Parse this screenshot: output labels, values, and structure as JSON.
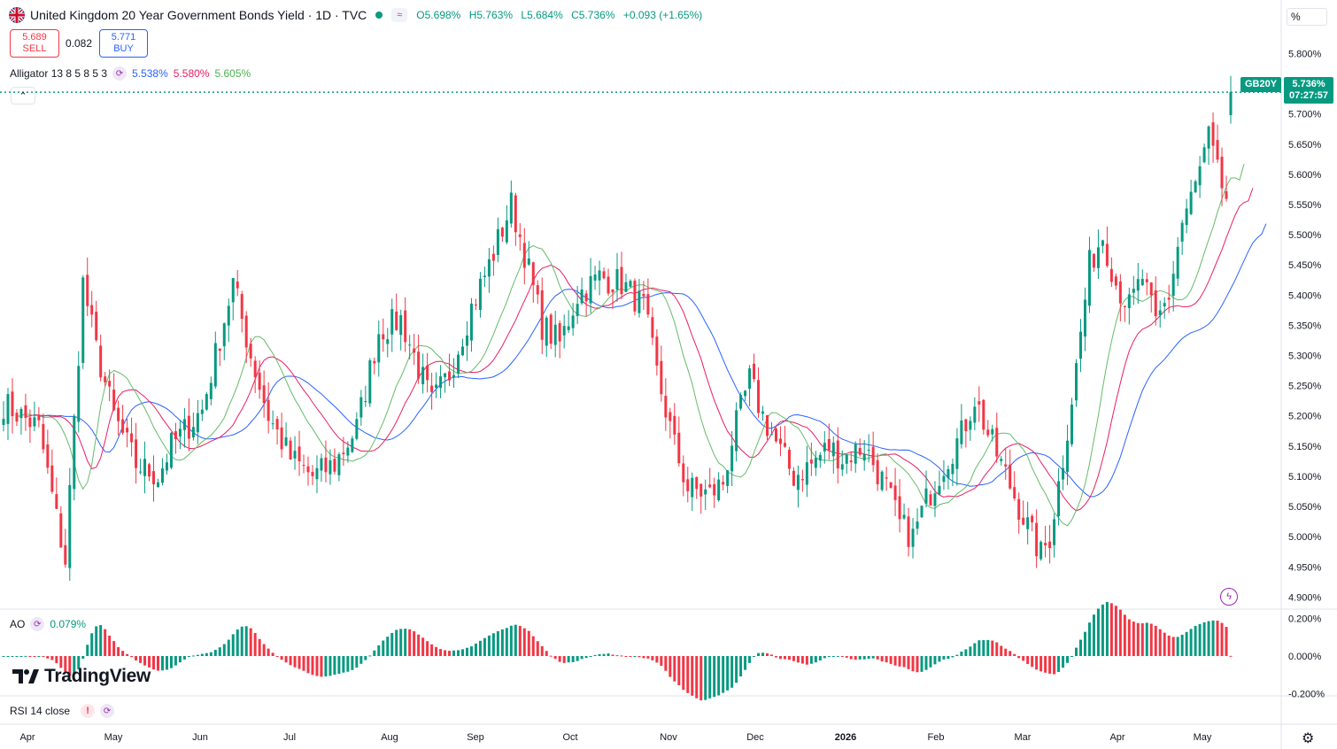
{
  "header": {
    "title": "United Kingdom 20 Year Government Bonds Yield · 1D · TVC",
    "open": "O5.698%",
    "high": "H5.763%",
    "low": "L5.684%",
    "close": "C5.736%",
    "change": "+0.093 (+1.65%)"
  },
  "trade": {
    "sell_price": "5.689",
    "sell_label": "SELL",
    "spread": "0.082",
    "buy_price": "5.771",
    "buy_label": "BUY"
  },
  "alligator": {
    "label": "Alligator 13 8 5 8 5 3",
    "jaw": "5.538%",
    "teeth": "5.580%",
    "lips": "5.605%",
    "jaw_color": "#2962ff",
    "teeth_color": "#e91e63",
    "lips_color": "#66bb6a"
  },
  "ao": {
    "label": "AO",
    "value": "0.079%"
  },
  "rsi": {
    "label": "RSI 14 close"
  },
  "brand": {
    "name": "TradingView"
  },
  "price_axis": {
    "unit": "%",
    "symbol_tag": "GB20Y",
    "last_price": "5.736%",
    "countdown": "07:27:57"
  },
  "colors": {
    "up": "#089981",
    "down": "#f23645"
  },
  "chart_data": {
    "type": "candlestick",
    "title": "United Kingdom 20 Year Government Bonds Yield",
    "interval": "1D",
    "ylim": [
      4.88,
      5.83
    ],
    "y_ticks": [
      "5.800%",
      "5.750%",
      "5.700%",
      "5.650%",
      "5.600%",
      "5.550%",
      "5.500%",
      "5.450%",
      "5.400%",
      "5.350%",
      "5.300%",
      "5.250%",
      "5.200%",
      "5.150%",
      "5.100%",
      "5.050%",
      "5.000%",
      "4.950%",
      "4.900%"
    ],
    "x_labels": [
      "Apr",
      "May",
      "Jun",
      "Jul",
      "Aug",
      "Sep",
      "Oct",
      "Nov",
      "Dec",
      "2026",
      "Feb",
      "Mar",
      "Apr",
      "May"
    ],
    "ohlc_anchors": [
      [
        0,
        5.22
      ],
      [
        8,
        5.18
      ],
      [
        12,
        5.03
      ],
      [
        14,
        4.96
      ],
      [
        18,
        5.42
      ],
      [
        21,
        5.31
      ],
      [
        25,
        5.2
      ],
      [
        30,
        5.12
      ],
      [
        35,
        5.1
      ],
      [
        38,
        5.15
      ],
      [
        45,
        5.21
      ],
      [
        50,
        5.36
      ],
      [
        52,
        5.42
      ],
      [
        56,
        5.3
      ],
      [
        60,
        5.2
      ],
      [
        65,
        5.13
      ],
      [
        70,
        5.1
      ],
      [
        75,
        5.12
      ],
      [
        80,
        5.18
      ],
      [
        85,
        5.34
      ],
      [
        90,
        5.36
      ],
      [
        93,
        5.3
      ],
      [
        97,
        5.22
      ],
      [
        101,
        5.27
      ],
      [
        106,
        5.38
      ],
      [
        110,
        5.45
      ],
      [
        115,
        5.55
      ],
      [
        118,
        5.47
      ],
      [
        122,
        5.35
      ],
      [
        126,
        5.32
      ],
      [
        130,
        5.4
      ],
      [
        135,
        5.43
      ],
      [
        140,
        5.42
      ],
      [
        145,
        5.38
      ],
      [
        148,
        5.27
      ],
      [
        152,
        5.15
      ],
      [
        155,
        5.08
      ],
      [
        160,
        5.07
      ],
      [
        163,
        5.09
      ],
      [
        165,
        5.16
      ],
      [
        169,
        5.26
      ],
      [
        172,
        5.2
      ],
      [
        176,
        5.14
      ],
      [
        179,
        5.1
      ],
      [
        183,
        5.12
      ],
      [
        187,
        5.15
      ],
      [
        190,
        5.13
      ],
      [
        195,
        5.15
      ],
      [
        200,
        5.08
      ],
      [
        203,
        5.02
      ],
      [
        206,
        5.0
      ],
      [
        209,
        5.06
      ],
      [
        213,
        5.12
      ],
      [
        217,
        5.17
      ],
      [
        220,
        5.23
      ],
      [
        223,
        5.17
      ],
      [
        226,
        5.12
      ],
      [
        230,
        5.05
      ],
      [
        233,
        5.0
      ],
      [
        235,
        4.97
      ],
      [
        237,
        5.0
      ],
      [
        240,
        5.13
      ],
      [
        243,
        5.28
      ],
      [
        246,
        5.45
      ],
      [
        249,
        5.5
      ],
      [
        252,
        5.42
      ],
      [
        255,
        5.38
      ],
      [
        258,
        5.43
      ],
      [
        261,
        5.35
      ],
      [
        264,
        5.4
      ],
      [
        267,
        5.52
      ],
      [
        270,
        5.58
      ],
      [
        273,
        5.66
      ],
      [
        275,
        5.6
      ],
      [
        277,
        5.56
      ],
      [
        278,
        5.74
      ]
    ],
    "alligator_jaw_last": 5.538,
    "alligator_teeth_last": 5.58,
    "alligator_lips_last": 5.605,
    "ao_ylim": [
      -0.22,
      0.22
    ],
    "ao_ticks": [
      "0.200%",
      "0.000%",
      "-0.200%"
    ],
    "ao_last": 0.079,
    "last_candle": {
      "open": 5.698,
      "high": 5.763,
      "low": 5.684,
      "close": 5.736
    }
  }
}
